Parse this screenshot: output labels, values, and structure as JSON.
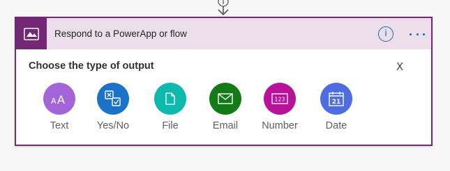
{
  "header": {
    "title": "Respond to a PowerApp or flow",
    "info_glyph": "i",
    "app_icon": "powerapps-icon"
  },
  "panel": {
    "title": "Choose the type of output",
    "close_label": "X"
  },
  "options": [
    {
      "label": "Text",
      "icon": "text-aa-icon",
      "color": "#a465d8"
    },
    {
      "label": "Yes/No",
      "icon": "yes-no-icon",
      "color": "#1a73c9"
    },
    {
      "label": "File",
      "icon": "file-icon",
      "color": "#0fb8ad"
    },
    {
      "label": "Email",
      "icon": "email-icon",
      "color": "#127a17"
    },
    {
      "label": "Number",
      "icon": "number-icon",
      "color": "#b8129b"
    },
    {
      "label": "Date",
      "icon": "date-icon",
      "color": "#4e6de3"
    }
  ],
  "date_icon_text": "21",
  "number_icon_text": "123",
  "text_icon_text": "AA",
  "colors": {
    "accent": "#742774",
    "header_bg": "#ecdeeb",
    "link_blue": "#0f6cbd"
  }
}
